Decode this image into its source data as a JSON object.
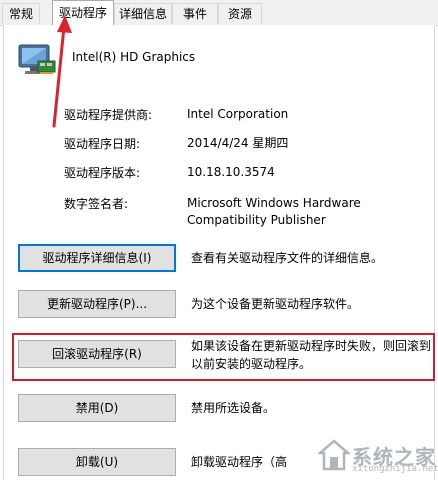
{
  "tabs": [
    "常规",
    "驱动程序",
    "详细信息",
    "事件",
    "资源"
  ],
  "device": {
    "name": "Intel(R) HD Graphics",
    "icon": "monitor-icon"
  },
  "info": [
    {
      "label": "驱动程序提供商:",
      "value": "Intel Corporation"
    },
    {
      "label": "驱动程序日期:",
      "value": "2014/4/24 星期四"
    },
    {
      "label": "驱动程序版本:",
      "value": "10.18.10.3574"
    },
    {
      "label": "数字签名者:",
      "value_line1": "Microsoft Windows Hardware",
      "value_line2": "Compatibility Publisher"
    }
  ],
  "buttons": [
    {
      "label": "驱动程序详细信息(I)",
      "desc": "查看有关驱动程序文件的详细信息。"
    },
    {
      "label": "更新驱动程序(P)...",
      "desc": "为这个设备更新驱动程序软件。"
    },
    {
      "label": "回滚驱动程序(R)",
      "desc_line1": "如果该设备在更新驱动程序时失败，则回滚到",
      "desc_line2": "以前安装的驱动程序。"
    },
    {
      "label": "禁用(D)",
      "desc": "禁用所选设备。"
    },
    {
      "label": "卸载(U)",
      "desc": "卸载驱动程序（高"
    }
  ],
  "watermark": {
    "text": "系统之家",
    "sub": "xitongzhijia.net"
  },
  "colors": {
    "highlight": "#c8212d",
    "arrow": "#d9232d",
    "focus": "#0078d7"
  }
}
